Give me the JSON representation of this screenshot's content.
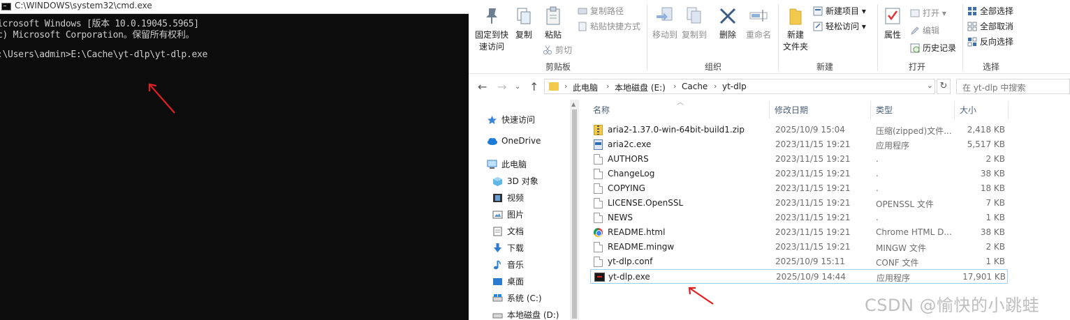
{
  "cmd": {
    "title": "C:\\WINDOWS\\system32\\cmd.exe",
    "lines": [
      "icrosoft Windows [版本 10.0.19045.5965]",
      "c) Microsoft Corporation。保留所有权利。",
      "",
      ":\\Users\\admin>E:\\Cache\\yt-dlp\\yt-dlp.exe"
    ]
  },
  "ribbon": {
    "clipboard": {
      "pin": "固定到快\n速访问",
      "copy": "复制",
      "paste": "粘贴",
      "copy_path": "复制路径",
      "paste_shortcut": "粘贴快捷方式",
      "cut": "剪切",
      "label": "剪贴板"
    },
    "organize": {
      "move_to": "移动到",
      "copy_to": "复制到",
      "delete": "删除",
      "rename": "重命名",
      "label": "组织"
    },
    "new": {
      "new_folder": "新建\n文件夹",
      "new_item": "新建项目 ▾",
      "easy_access": "轻松访问 ▾",
      "label": "新建"
    },
    "open": {
      "properties": "属性",
      "open": "打开 ▾",
      "edit": "编辑",
      "history": "历史记录",
      "label": "打开"
    },
    "select": {
      "select_all": "全部选择",
      "select_none": "全部取消",
      "invert": "反向选择",
      "label": "选择"
    }
  },
  "address": {
    "crumbs": [
      "此电脑",
      "本地磁盘 (E:)",
      "Cache",
      "yt-dlp"
    ],
    "search_placeholder": "在 yt-dlp 中搜索"
  },
  "nav": {
    "items": [
      {
        "label": "快速访问",
        "icon": "star-icon"
      },
      {
        "label": "OneDrive",
        "icon": "cloud-icon"
      },
      {
        "label": "此电脑",
        "icon": "computer-icon"
      },
      {
        "label": "3D 对象",
        "icon": "cube-icon"
      },
      {
        "label": "视频",
        "icon": "video-icon"
      },
      {
        "label": "图片",
        "icon": "picture-icon"
      },
      {
        "label": "文档",
        "icon": "document-icon"
      },
      {
        "label": "下载",
        "icon": "download-icon"
      },
      {
        "label": "音乐",
        "icon": "music-icon"
      },
      {
        "label": "桌面",
        "icon": "desktop-icon"
      },
      {
        "label": "系统 (C:)",
        "icon": "drive-icon"
      },
      {
        "label": "本地磁盘 (D:)",
        "icon": "drive-icon"
      }
    ]
  },
  "columns": {
    "name": "名称",
    "modified": "修改日期",
    "type": "类型",
    "size": "大小"
  },
  "files": [
    {
      "name": "aria2-1.37.0-win-64bit-build1.zip",
      "modified": "2025/10/9 15:04",
      "type": "压缩(zipped)文件...",
      "size": "2,418 KB",
      "icon": "zip-icon"
    },
    {
      "name": "aria2c.exe",
      "modified": "2023/11/15 19:21",
      "type": "应用程序",
      "size": "5,517 KB",
      "icon": "exe-icon"
    },
    {
      "name": "AUTHORS",
      "modified": "2023/11/15 19:21",
      "type": ".",
      "size": "2 KB",
      "icon": "file-icon"
    },
    {
      "name": "ChangeLog",
      "modified": "2023/11/15 19:21",
      "type": ".",
      "size": "38 KB",
      "icon": "file-icon"
    },
    {
      "name": "COPYING",
      "modified": "2023/11/15 19:21",
      "type": ".",
      "size": "18 KB",
      "icon": "file-icon"
    },
    {
      "name": "LICENSE.OpenSSL",
      "modified": "2023/11/15 19:21",
      "type": "OPENSSL 文件",
      "size": "7 KB",
      "icon": "file-icon"
    },
    {
      "name": "NEWS",
      "modified": "2023/11/15 19:21",
      "type": ".",
      "size": "1 KB",
      "icon": "file-icon"
    },
    {
      "name": "README.html",
      "modified": "2023/11/15 19:21",
      "type": "Chrome HTML D...",
      "size": "38 KB",
      "icon": "chrome-html-icon"
    },
    {
      "name": "README.mingw",
      "modified": "2023/11/15 19:21",
      "type": "MINGW 文件",
      "size": "2 KB",
      "icon": "file-icon"
    },
    {
      "name": "yt-dlp.conf",
      "modified": "2025/10/9 15:11",
      "type": "CONF 文件",
      "size": "1 KB",
      "icon": "file-icon"
    },
    {
      "name": "yt-dlp.exe",
      "modified": "2025/10/9 14:44",
      "type": "应用程序",
      "size": "17,901 KB",
      "icon": "terminal-exe-icon",
      "selected": true
    }
  ],
  "watermark": "CSDN @愉快的小跳蛙",
  "colors": {
    "accent": "#0078d7",
    "selection_border": "#99d1ff",
    "annotation_arrow": "#e02020",
    "cmd_background": "#0c0c0c",
    "cmd_text": "#cccccc"
  }
}
